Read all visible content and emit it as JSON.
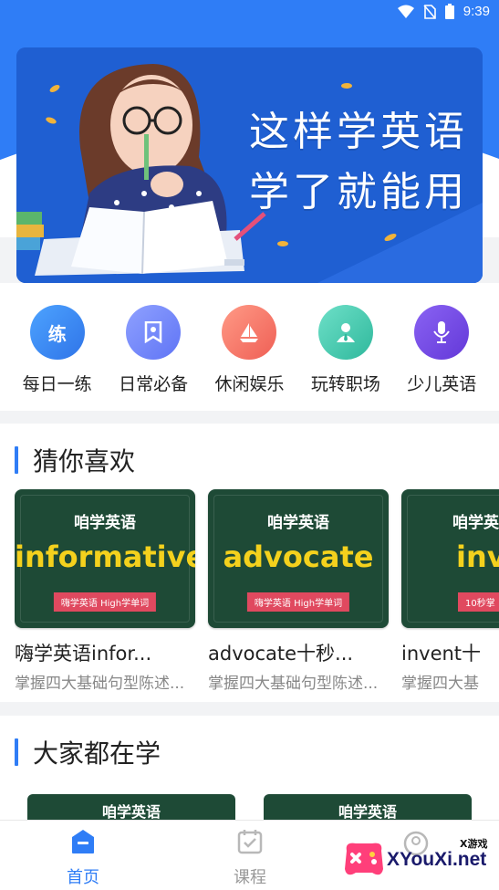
{
  "status": {
    "time": "9:39"
  },
  "banner": {
    "line1": "这样学英语",
    "line2": "学了就能用"
  },
  "categories": [
    {
      "label": "每日一练",
      "icon": "lian-icon",
      "glyph": "练"
    },
    {
      "label": "日常必备",
      "icon": "bookmark-icon"
    },
    {
      "label": "休闲娱乐",
      "icon": "sailboat-icon"
    },
    {
      "label": "玩转职场",
      "icon": "person-icon"
    },
    {
      "label": "少儿英语",
      "icon": "microphone-icon"
    }
  ],
  "guess": {
    "title": "猜你喜欢",
    "cards": [
      {
        "brand": "咱学英语",
        "word": "informative",
        "tag": "嗨学英语 High学单词",
        "title": "嗨学英语infor...",
        "subtitle": "掌握四大基础句型陈述..."
      },
      {
        "brand": "咱学英语",
        "word": "advocate",
        "tag": "嗨学英语 High学单词",
        "title": "advocate十秒...",
        "subtitle": "掌握四大基础句型陈述..."
      },
      {
        "brand": "咱学英语",
        "word": "inv",
        "tag": "10秒掌",
        "title": "invent十",
        "subtitle": "掌握四大基"
      }
    ]
  },
  "popular": {
    "title": "大家都在学",
    "cards": [
      {
        "brand": "咱学英语"
      },
      {
        "brand": "咱学英语"
      }
    ]
  },
  "tabs": [
    {
      "label": "首页",
      "icon": "home-icon",
      "active": true
    },
    {
      "label": "课程",
      "icon": "calendar-check-icon",
      "active": false
    }
  ],
  "watermark": {
    "small": "X游戏",
    "big": "XYouXi.net"
  },
  "colors": {
    "primary": "#2f7df6",
    "chalkboard": "#1e4a36",
    "word_yellow": "#f4d11d",
    "tag_red": "#e0495f"
  }
}
